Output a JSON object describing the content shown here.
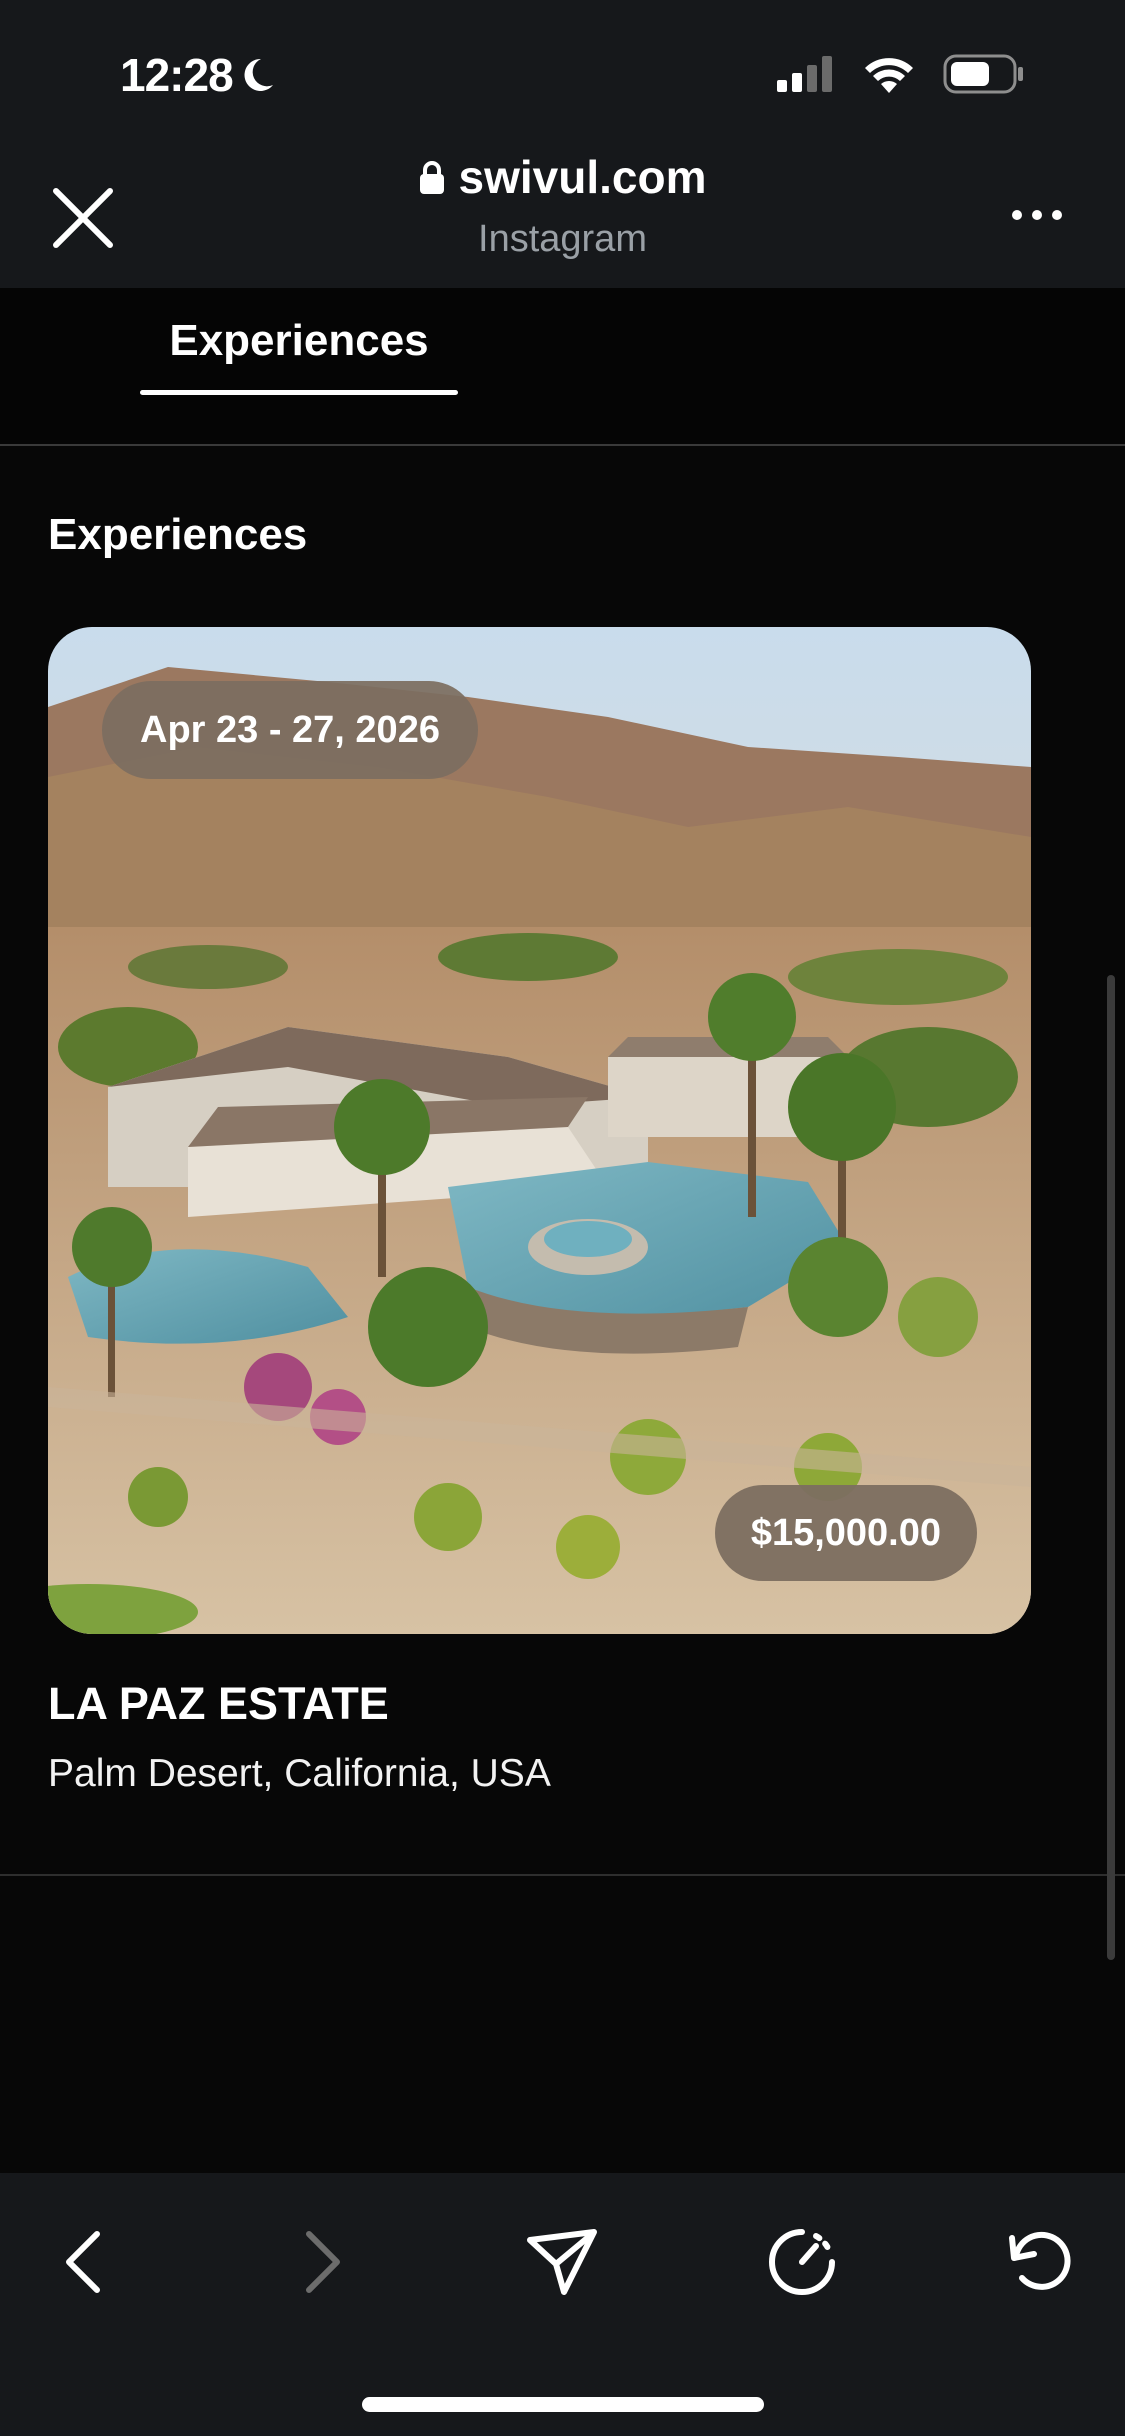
{
  "status_bar": {
    "time": "12:28",
    "icons": [
      "moon-icon",
      "signal-icon",
      "wifi-icon",
      "battery-icon"
    ]
  },
  "browser": {
    "url": "swivul.com",
    "source": "Instagram",
    "icons": [
      "close-icon",
      "lock-icon",
      "more-icon"
    ]
  },
  "tabs": [
    {
      "label": "Experiences",
      "active": true
    }
  ],
  "section": {
    "title": "Experiences"
  },
  "listing": {
    "dates": "Apr 23 - 27, 2026",
    "price": "$15,000.00",
    "title": "LA PAZ ESTATE",
    "location": "Palm Desert, California, USA"
  },
  "toolbar": {
    "icons": [
      "back-icon",
      "forward-icon",
      "share-icon",
      "compass-icon",
      "reload-icon"
    ]
  },
  "colors": {
    "background": "#070707",
    "bars": "#16181b",
    "badge": "#7c6e60"
  }
}
